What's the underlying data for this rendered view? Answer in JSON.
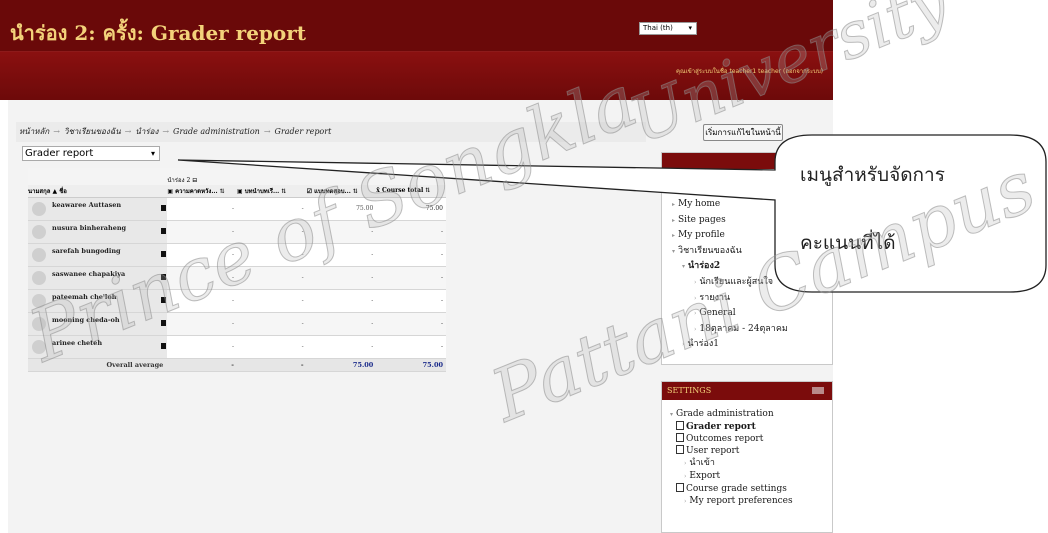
{
  "header": {
    "site_title": "นำร่อง 2: ครั้ง: Grader report",
    "language": "Thai (th)",
    "login_info": "คุณเข้าสู่ระบบในชื่อ teacher1 teacher (ออกจากระบบ)"
  },
  "breadcrumb": {
    "items": [
      "หน้าหลัก",
      "วิชาเรียนของฉัน",
      "นำร่อง",
      "Grade administration",
      "Grader report"
    ],
    "separator": "→"
  },
  "toolbar": {
    "edit_button": "เริ่มการแก้ไขในหน้านี้",
    "report_select": "Grader report"
  },
  "grader": {
    "category_label": "นำร่อง 2",
    "header_sort_label": "นามสกุล",
    "header_first_label": "ชื่อ",
    "columns": [
      "ความคาดหวัง...",
      "บทนำบทเรี...",
      "แบบทดสอบ...",
      "Course total"
    ],
    "rows": [
      {
        "name": "keawaree Auttasen",
        "grades": [
          "-",
          "-",
          "75.00",
          "75.00"
        ]
      },
      {
        "name": "nusura binheraheng",
        "grades": [
          "-",
          "-",
          "-",
          "-"
        ]
      },
      {
        "name": "sarefah bungoding",
        "grades": [
          "-",
          "-",
          "-",
          "-"
        ]
      },
      {
        "name": "saswanee chapakiya",
        "grades": [
          "-",
          "-",
          "-",
          "-"
        ]
      },
      {
        "name": "pateemah che'loh",
        "grades": [
          "-",
          "-",
          "-",
          "-"
        ]
      },
      {
        "name": "mooning cheda-oh",
        "grades": [
          "-",
          "-",
          "-",
          "-"
        ]
      },
      {
        "name": "arinee cheteh",
        "grades": [
          "-",
          "-",
          "-",
          "-"
        ]
      }
    ],
    "average_label": "Overall average",
    "averages": [
      "-",
      "-",
      "75.00",
      "75.00"
    ]
  },
  "navigation": {
    "items": [
      {
        "label": "My home",
        "level": 1
      },
      {
        "label": "Site pages",
        "level": 1
      },
      {
        "label": "My profile",
        "level": 1
      },
      {
        "label": "วิชาเรียนของฉัน",
        "level": 1
      },
      {
        "label": "นำร่อง2",
        "level": 2,
        "bold": true
      },
      {
        "label": "นักเรียนและผู้สนใจ",
        "level": 3
      },
      {
        "label": "รายงาน",
        "level": 3
      },
      {
        "label": "General",
        "level": 3
      },
      {
        "label": "18ตุลาคม - 24ตุลาคม",
        "level": 3
      },
      {
        "label": "นำร่อง1",
        "level": 2
      }
    ]
  },
  "settings": {
    "title": "SETTINGS",
    "items": [
      {
        "label": "Grade administration",
        "type": "folder"
      },
      {
        "label": "Grader report",
        "type": "doc",
        "bold": true
      },
      {
        "label": "Outcomes report",
        "type": "doc"
      },
      {
        "label": "User report",
        "type": "doc"
      },
      {
        "label": "นำเข้า",
        "type": "sub"
      },
      {
        "label": "Export",
        "type": "sub"
      },
      {
        "label": "Course grade settings",
        "type": "doc"
      },
      {
        "label": "My report preferences",
        "type": "sub2"
      }
    ]
  },
  "callout": {
    "line1": "เมนูสำหรับจัดการ",
    "line2": "คะแนนที่ได้"
  },
  "watermark": {
    "line1": "Prince of Songkla",
    "line2": "Pattani Campus",
    "line3": "University"
  },
  "colors": {
    "header_dark": "#6a0909",
    "header_main": "#7b0c0c",
    "title_gold": "#f3d27a",
    "average_blue": "#1a2a8a"
  }
}
